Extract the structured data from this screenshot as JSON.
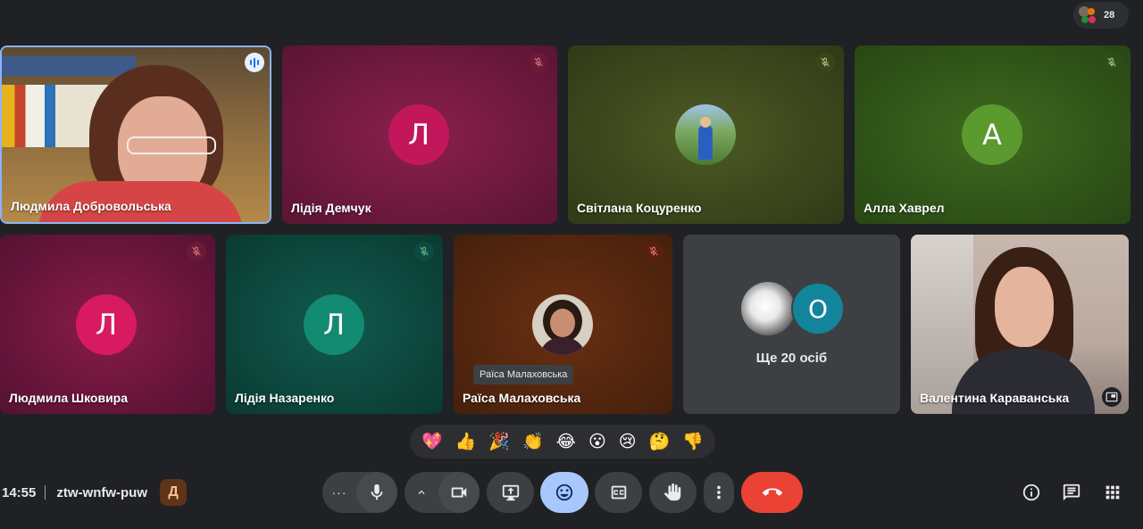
{
  "top": {
    "participant_count": "28"
  },
  "tiles": [
    {
      "id": "ludmyla-d",
      "name": "Людмила Добровольська",
      "speaking": true
    },
    {
      "id": "lidiya-d",
      "name": "Лідія Демчук",
      "initial": "Л",
      "muted": true
    },
    {
      "id": "svitlana-k",
      "name": "Світлана Коцуренко",
      "muted": true
    },
    {
      "id": "alla-kh",
      "name": "Алла Хаврел",
      "initial": "А",
      "muted": true
    },
    {
      "id": "ludmyla-sh",
      "name": "Людмила Шковира",
      "initial": "Л",
      "muted": true
    },
    {
      "id": "lidiya-n",
      "name": "Лідія Назаренко",
      "initial": "Л",
      "muted": true
    },
    {
      "id": "raisa-m",
      "name": "Раїса Малаховська",
      "tooltip": "Раїса Малаховська",
      "muted": true
    },
    {
      "id": "others",
      "others_label": "Ще 20 осіб",
      "initial": "О"
    },
    {
      "id": "valentyna-k",
      "name": "Валентина Караванська"
    }
  ],
  "reactions": [
    "💖",
    "👍",
    "🎉",
    "👏",
    "😂",
    "😮",
    "😢",
    "🤔",
    "👎"
  ],
  "bottom": {
    "time": "14:55",
    "meeting_code": "ztw-wnfw-puw",
    "activity_badge": "Д"
  },
  "colors": {
    "background": "#202124",
    "control": "#3c4043",
    "end_call": "#ea4335",
    "reaction_active": "#a8c7fa",
    "speaking_border": "#8ab4f8"
  }
}
